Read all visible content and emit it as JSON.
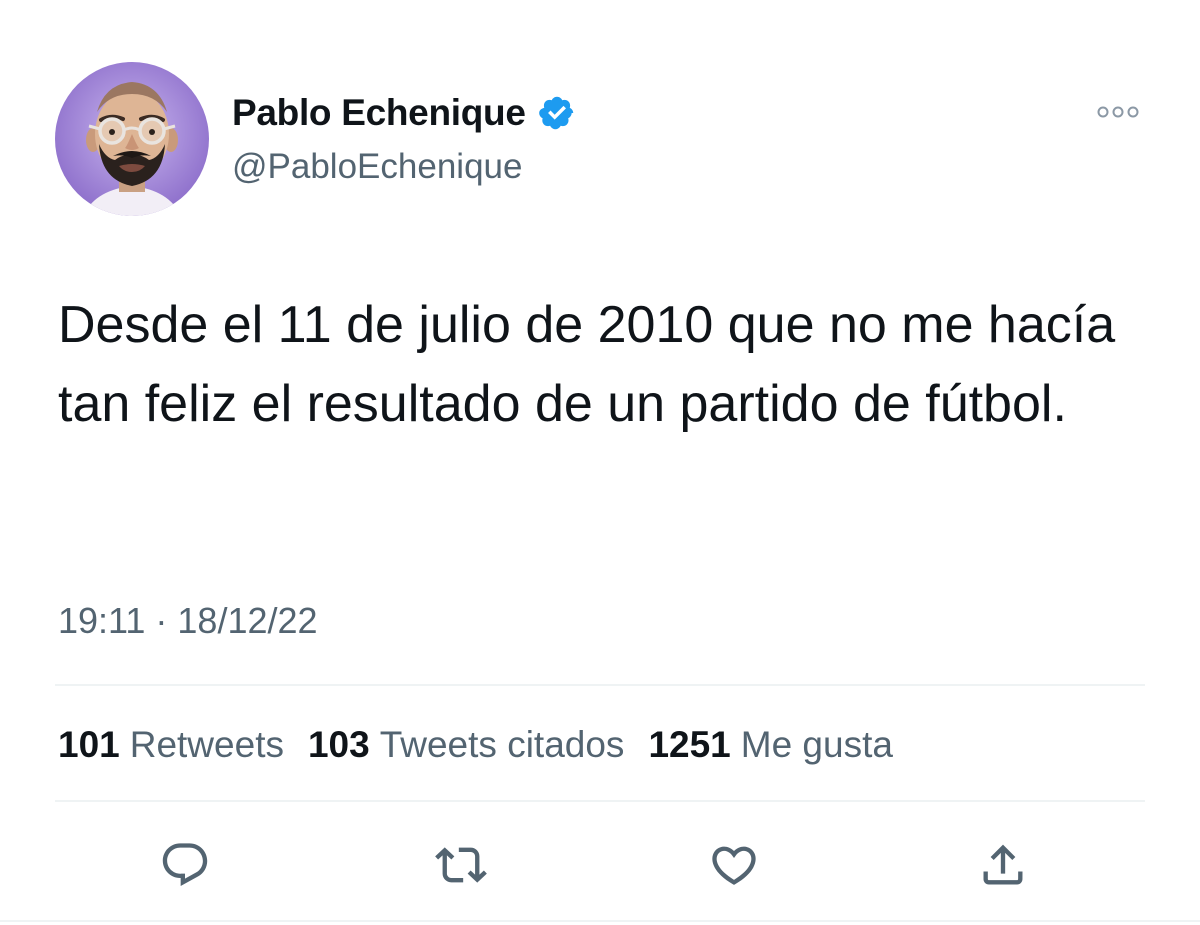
{
  "author": {
    "display_name": "Pablo Echenique",
    "handle": "@PabloEchenique",
    "verified": true,
    "avatar_icon": "profile-portrait-illustration"
  },
  "tweet": {
    "text": "Desde el 11 de julio de 2010 que no me hacía tan feliz el resultado de un partido de fútbol.",
    "timestamp": "19:11 · 18/12/22"
  },
  "stats": [
    {
      "count": "101",
      "label": "Retweets"
    },
    {
      "count": "103",
      "label": "Tweets citados"
    },
    {
      "count": "1251",
      "label": "Me gusta"
    }
  ],
  "actions": [
    "reply-icon",
    "retweet-icon",
    "like-icon",
    "share-icon"
  ],
  "colors": {
    "text_primary": "#0f1419",
    "text_secondary": "#536471",
    "verified_blue": "#1d9bf0",
    "divider": "#eff3f4"
  }
}
